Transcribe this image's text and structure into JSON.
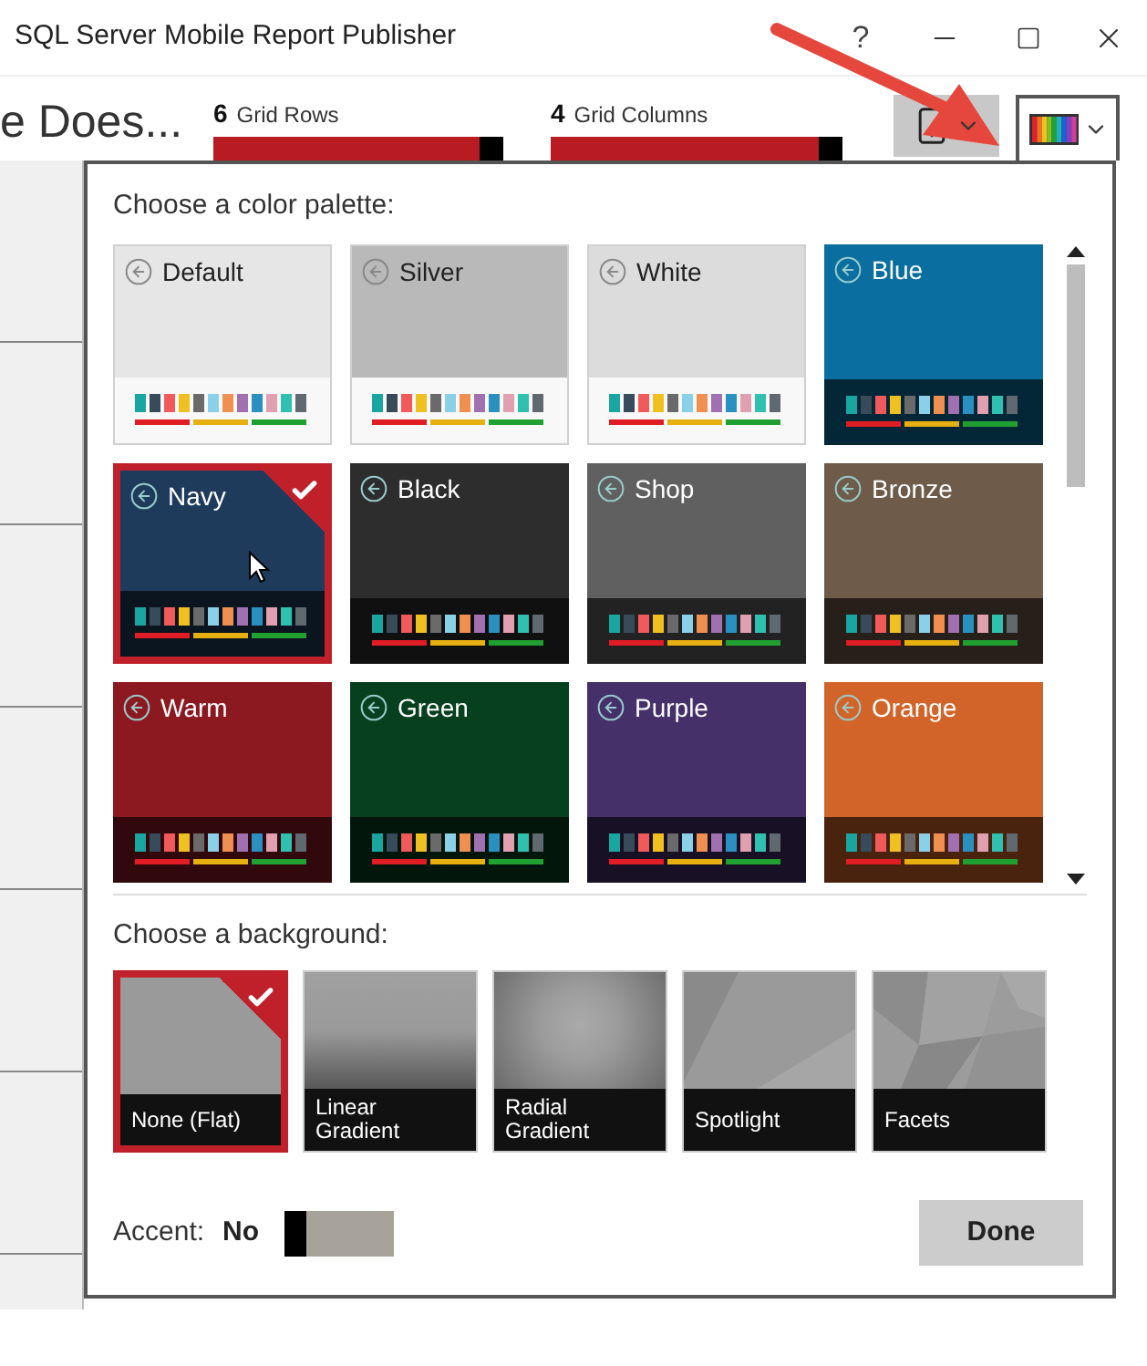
{
  "window": {
    "title": "SQL Server Mobile Report Publisher",
    "help": "?"
  },
  "header": {
    "title": "e Does...",
    "sliders": [
      {
        "value": "6",
        "label": "Grid Rows",
        "level": 0.92
      },
      {
        "value": "4",
        "label": "Grid Columns",
        "level": 0.93
      }
    ]
  },
  "palette_panel": {
    "heading": "Choose a color palette:",
    "palettes": [
      {
        "name": "Default",
        "color": "#e6e6e6",
        "kind": "light",
        "selected": false
      },
      {
        "name": "Silver",
        "color": "#b9b9b9",
        "kind": "light",
        "selected": false
      },
      {
        "name": "White",
        "color": "#dcdcdc",
        "kind": "light",
        "selected": false
      },
      {
        "name": "Blue",
        "color": "#0a6fa0",
        "kind": "dark",
        "selected": false
      },
      {
        "name": "Navy",
        "color": "#1f3b5c",
        "kind": "dark",
        "selected": true
      },
      {
        "name": "Black",
        "color": "#2d2d2d",
        "kind": "dark",
        "selected": false
      },
      {
        "name": "Shop",
        "color": "#606060",
        "kind": "dark",
        "selected": false
      },
      {
        "name": "Bronze",
        "color": "#6e5b49",
        "kind": "dark",
        "selected": false
      },
      {
        "name": "Warm",
        "color": "#8c1820",
        "kind": "dark",
        "selected": false
      },
      {
        "name": "Green",
        "color": "#06401f",
        "kind": "dark",
        "selected": false
      },
      {
        "name": "Purple",
        "color": "#45306a",
        "kind": "dark",
        "selected": false
      },
      {
        "name": "Orange",
        "color": "#d2642a",
        "kind": "dark",
        "selected": false
      }
    ],
    "background_heading": "Choose a background:",
    "backgrounds": [
      {
        "label": "None (Flat)",
        "kind": "flat",
        "selected": true
      },
      {
        "label": "Linear Gradient",
        "kind": "linear",
        "selected": false
      },
      {
        "label": "Radial Gradient",
        "kind": "radial",
        "selected": false
      },
      {
        "label": "Spotlight",
        "kind": "spotlight",
        "selected": false
      },
      {
        "label": "Facets",
        "kind": "facets",
        "selected": false
      }
    ],
    "accent": {
      "label": "Accent:",
      "value": "No",
      "on": false
    },
    "done": "Done"
  }
}
